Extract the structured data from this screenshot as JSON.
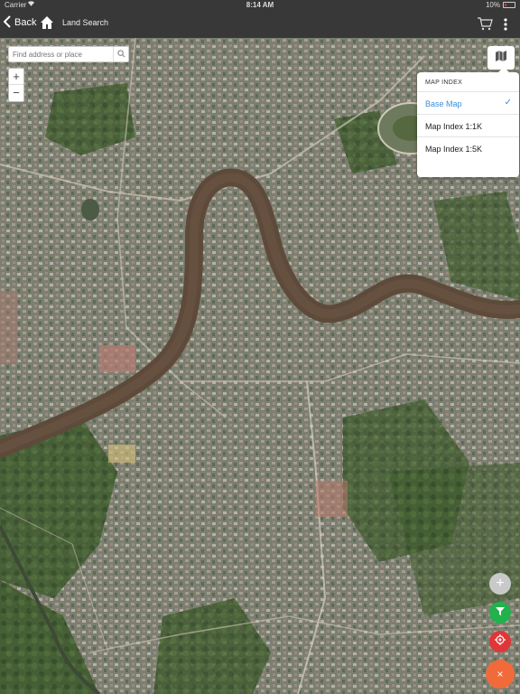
{
  "status_bar": {
    "carrier": "Carrier",
    "time": "8:14 AM",
    "battery": "10%"
  },
  "nav": {
    "back_label": "Back",
    "title": "Land Search"
  },
  "search": {
    "placeholder": "Find address or place"
  },
  "zoom": {
    "in_label": "+",
    "out_label": "−"
  },
  "map_index": {
    "header": "MAP INDEX",
    "items": [
      {
        "label": "Base Map",
        "selected": true
      },
      {
        "label": "Map Index 1:1K",
        "selected": false
      },
      {
        "label": "Map Index 1:5K",
        "selected": false
      }
    ],
    "check_glyph": "✓"
  },
  "fabs": {
    "add_glyph": "+",
    "close_glyph": "×"
  },
  "colors": {
    "bar": "#383838",
    "accent": "#3a8fd8",
    "filter": "#22b14c",
    "locate": "#e0363a",
    "close": "#f06a3a",
    "river": "#5e4a3a"
  },
  "icons": [
    "back-chevron-icon",
    "home-icon",
    "cart-icon",
    "more-icon",
    "search-icon",
    "map-layers-icon",
    "filter-icon",
    "locate-icon",
    "wifi-icon",
    "battery-icon"
  ]
}
